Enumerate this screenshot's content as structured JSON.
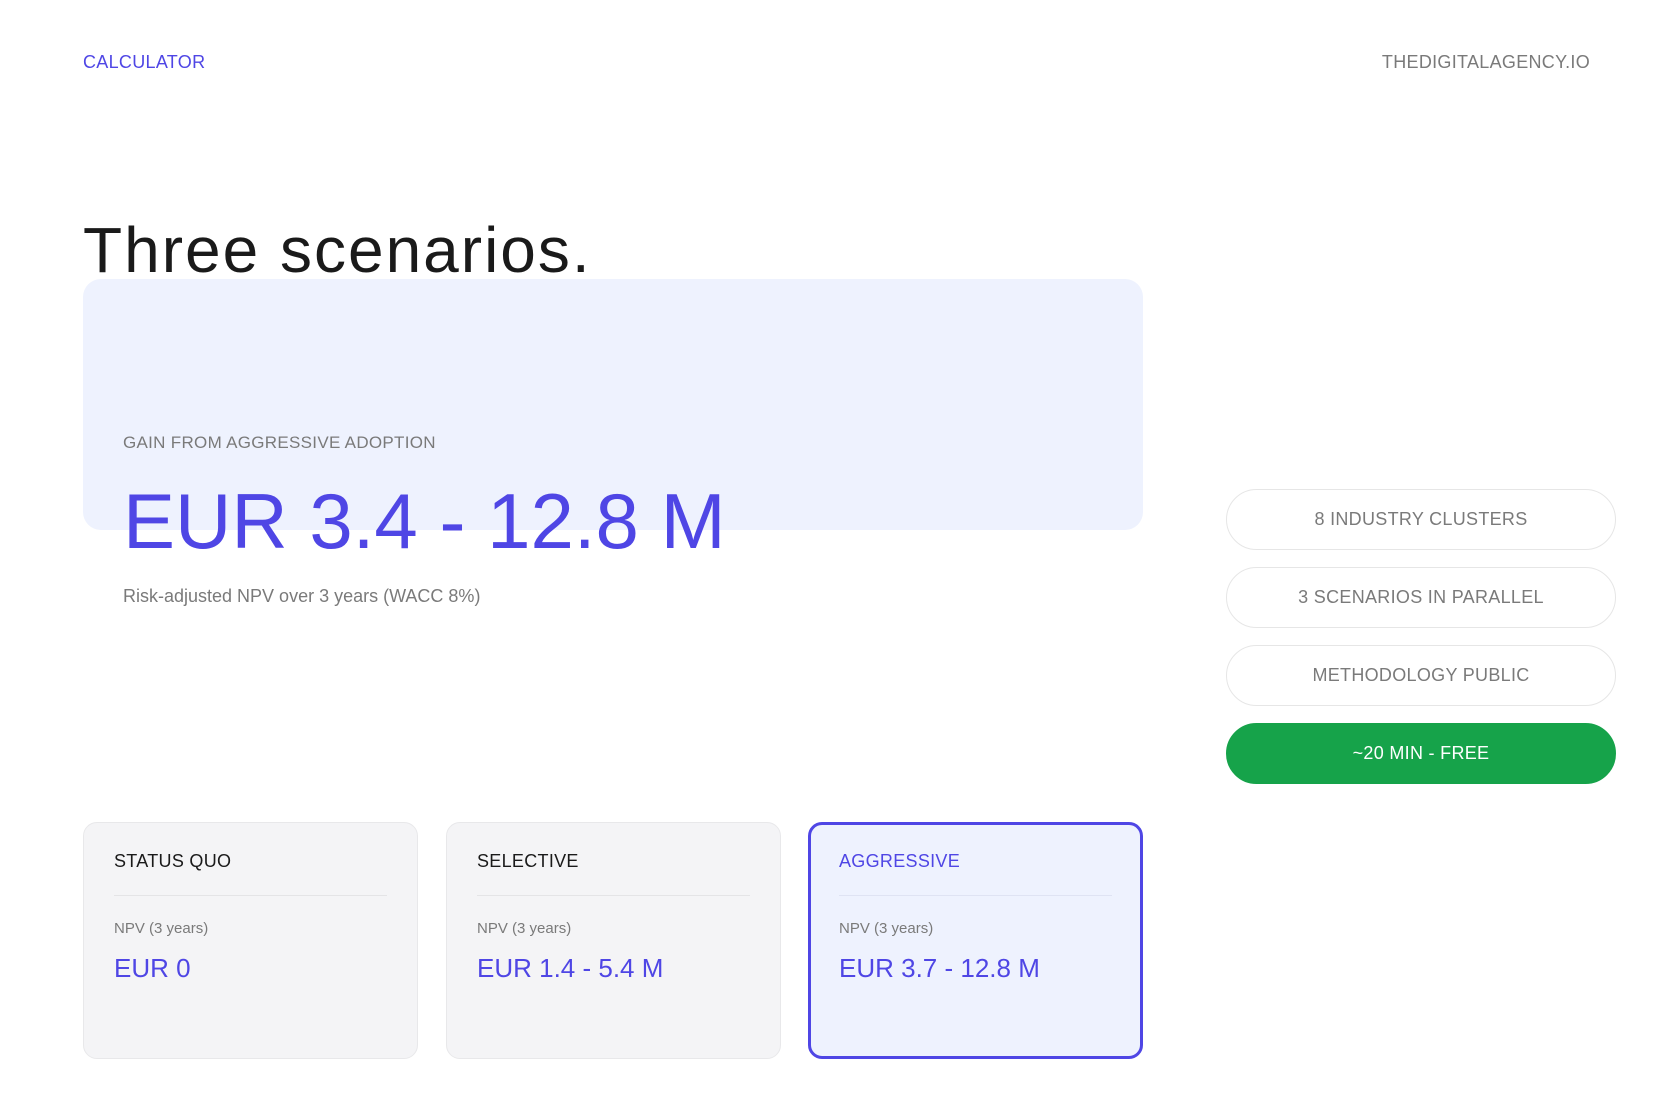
{
  "header": {
    "left_label": "CALCULATOR",
    "right_label": "THEDIGITALAGENCY.IO"
  },
  "headline": {
    "title": "Three scenarios."
  },
  "hero": {
    "label": "GAIN FROM AGGRESSIVE ADOPTION",
    "value": "EUR 3.4 - 12.8 M",
    "subtext": "Risk-adjusted NPV over 3 years (WACC 8%)"
  },
  "features": [
    {
      "label": "8 INDUSTRY CLUSTERS"
    },
    {
      "label": "3 SCENARIOS IN PARALLEL"
    },
    {
      "label": "METHODOLOGY PUBLIC"
    },
    {
      "label": "~20 MIN - FREE"
    }
  ],
  "scenarios": [
    {
      "name": "STATUS QUO",
      "metric_label": "NPV (3 years)",
      "value": "EUR 0"
    },
    {
      "name": "SELECTIVE",
      "metric_label": "NPV (3 years)",
      "value": "EUR 1.4 - 5.4 M"
    },
    {
      "name": "AGGRESSIVE",
      "metric_label": "NPV (3 years)",
      "value": "EUR 3.7 - 12.8 M"
    }
  ],
  "colors": {
    "accent": "#4f46e5",
    "highlight_bg": "#eef2fe",
    "cta_green": "#16a34a",
    "muted_text": "#7a7a7a"
  }
}
